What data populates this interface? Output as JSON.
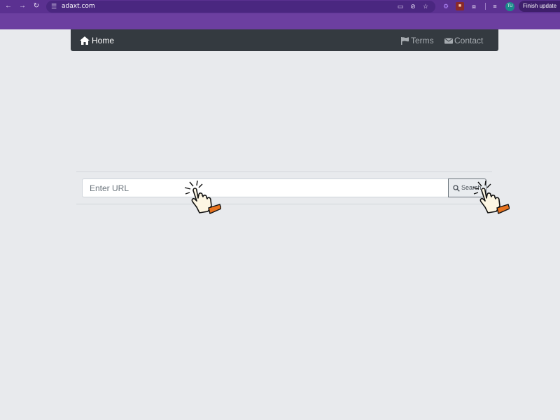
{
  "browser": {
    "url": "adaxt.com",
    "avatar_initials": "TU",
    "finish_update_label": "Finish update",
    "icons": {
      "back": "arrow-left-icon",
      "forward": "arrow-right-icon",
      "reload": "reload-icon",
      "site_info": "tune-icon",
      "cast": "cast-icon",
      "eye_off": "eye-off-icon",
      "bookmark": "star-icon",
      "extensions": "puzzle-icon"
    },
    "colors": {
      "frame": "#6c3fa0",
      "toolbar": "#5b3191"
    }
  },
  "navbar": {
    "home_label": "Home",
    "terms_label": "Terms",
    "contact_label": "Contact",
    "icons": {
      "home": "home-icon",
      "terms": "flag-icon",
      "contact": "envelope-icon"
    },
    "colors": {
      "background": "#343a40",
      "active": "#ffffff",
      "muted": "#a6abb0"
    }
  },
  "search": {
    "placeholder": "Enter URL",
    "value": "",
    "button_label": "Search",
    "button_icon": "search-icon"
  },
  "annotations": {
    "pointer_icon": "hand-pointer-icon"
  }
}
